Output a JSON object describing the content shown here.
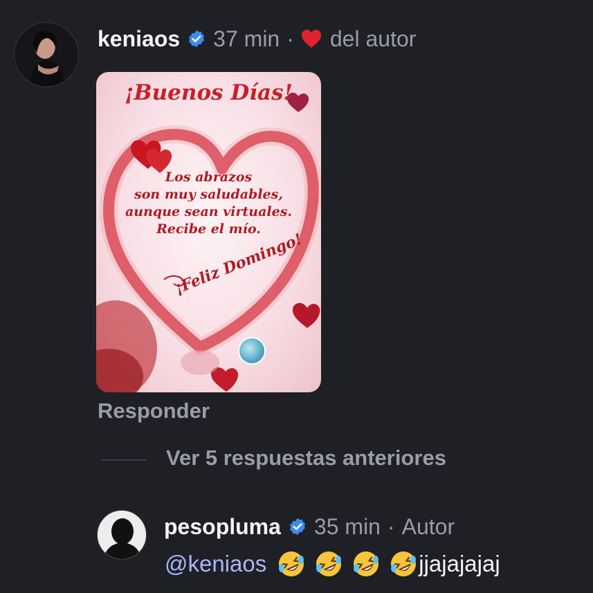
{
  "comment": {
    "username": "keniaos",
    "time": "37 min",
    "separator": "·",
    "author_liked_label": "del autor",
    "gif": {
      "title": "¡Buenos Días!",
      "message_lines": [
        "Los abrazos",
        "son muy saludables,",
        "aunque sean virtuales.",
        "Recibe el mío."
      ],
      "footer": "¡Feliz Domingo!"
    },
    "reply_label": "Responder"
  },
  "thread": {
    "view_previous_label": "Ver 5 respuestas anteriores"
  },
  "reply": {
    "username": "pesopluma",
    "time": "35 min",
    "separator": "·",
    "author_badge": "Autor",
    "mention": "@keniaos",
    "emoji_icons": [
      "rolling-laughing-emoji",
      "rolling-laughing-emoji",
      "rolling-laughing-emoji",
      "rolling-laughing-emoji"
    ],
    "text": "jjajajajaj"
  },
  "colors": {
    "background": "#1f2026",
    "primary_text": "#f4f4f6",
    "secondary_text": "#9a9ca6",
    "verified_blue": "#3b8bf0",
    "heart_red": "#e0242f",
    "mention_blue": "#a9b6f4"
  }
}
